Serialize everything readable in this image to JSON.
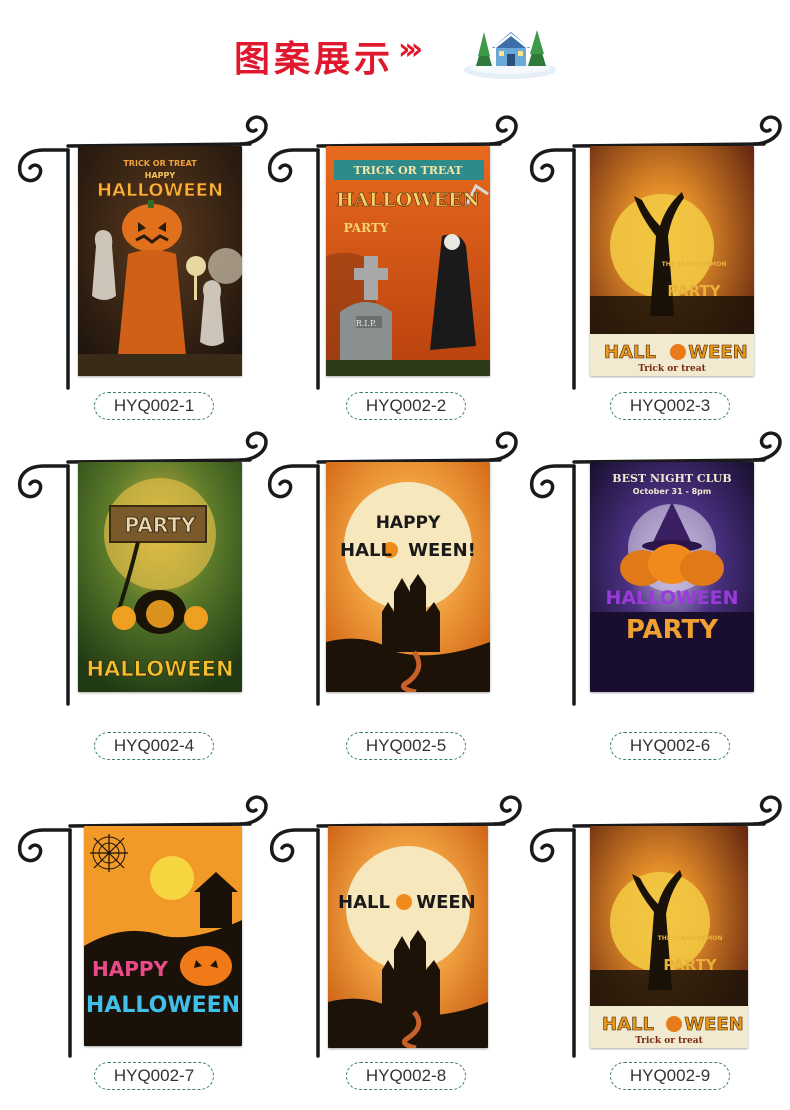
{
  "header": {
    "title": "图案展示",
    "arrows": "›››",
    "icon": "snowy-house-icon"
  },
  "colors": {
    "title_red": "#e0182d",
    "label_border": "#3a8066"
  },
  "products": [
    {
      "code": "HYQ002-1",
      "texts": [
        "TRICK OR TREAT",
        "HAPPY",
        "HALLOWEEN"
      ]
    },
    {
      "code": "HYQ002-2",
      "texts": [
        "TRICK OR TREAT",
        "HALLOWEEN",
        "PARTY",
        "R.I.P."
      ]
    },
    {
      "code": "HYQ002-3",
      "texts": [
        "THE CLASH DEMON",
        "PARTY",
        "HALL",
        "WEEN",
        "Trick or treat"
      ]
    },
    {
      "code": "HYQ002-4",
      "texts": [
        "PARTY",
        "HALLOWEEN"
      ]
    },
    {
      "code": "HYQ002-5",
      "texts": [
        "HAPPY",
        "HALL",
        "WEEN!"
      ]
    },
    {
      "code": "HYQ002-6",
      "texts": [
        "BEST NIGHT CLUB",
        "October 31 - 8pm",
        "HALLOWEEN",
        "PARTY"
      ]
    },
    {
      "code": "HYQ002-7",
      "texts": [
        "HAPPY",
        "HALLOWEEN"
      ]
    },
    {
      "code": "HYQ002-8",
      "texts": [
        "HALL",
        "WEEN"
      ]
    },
    {
      "code": "HYQ002-9",
      "texts": [
        "THE CLASH DEMON",
        "PARTY",
        "HALL",
        "WEEN",
        "Trick or treat"
      ]
    }
  ]
}
